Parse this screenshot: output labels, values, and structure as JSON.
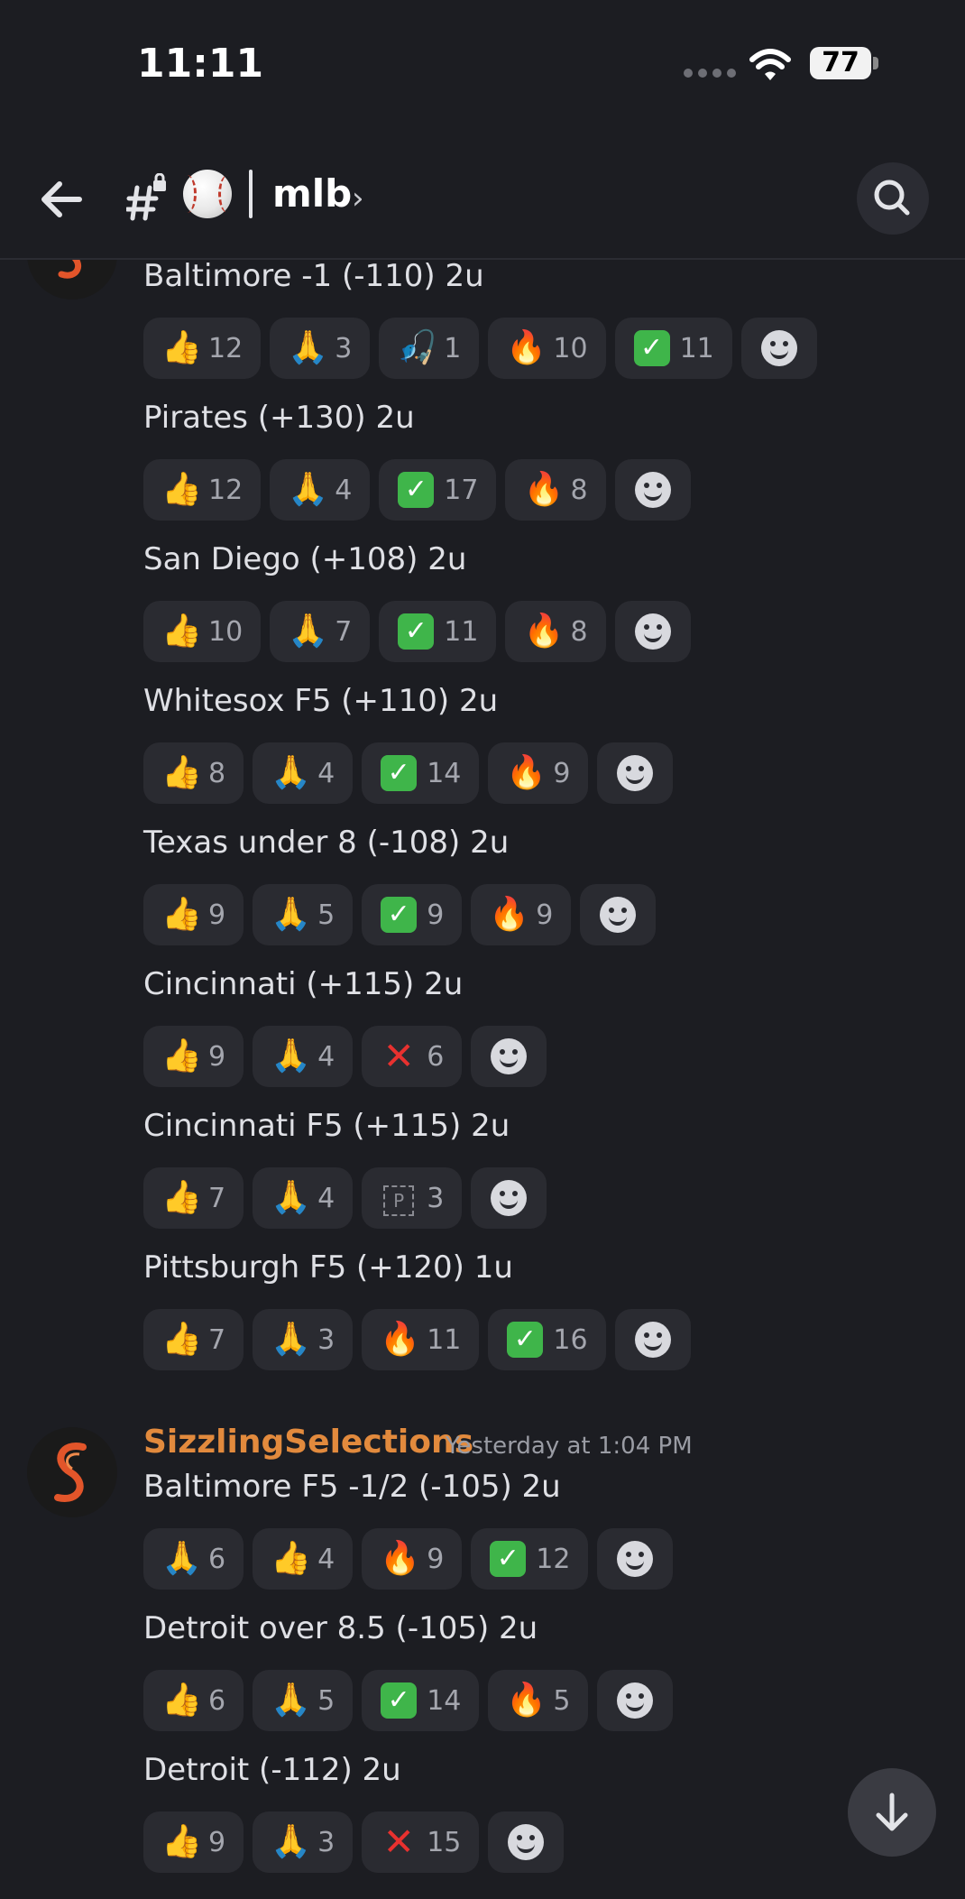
{
  "status_bar": {
    "time": "11:11",
    "battery": "77"
  },
  "header": {
    "channel_name": "mlb"
  },
  "messages": [
    {
      "lines": [
        {
          "text": "Baltimore -1 (-110) 2u",
          "reactions": [
            {
              "emoji": "👍",
              "count": "12"
            },
            {
              "emoji": "🙏",
              "count": "3"
            },
            {
              "emoji": "🎣",
              "count": "1"
            },
            {
              "emoji": "🔥",
              "count": "10"
            },
            {
              "emoji": "✅",
              "count": "11"
            }
          ]
        },
        {
          "text": "Pirates (+130) 2u",
          "reactions": [
            {
              "emoji": "👍",
              "count": "12"
            },
            {
              "emoji": "🙏",
              "count": "4"
            },
            {
              "emoji": "✅",
              "count": "17"
            },
            {
              "emoji": "🔥",
              "count": "8"
            }
          ]
        },
        {
          "text": "San Diego (+108) 2u",
          "reactions": [
            {
              "emoji": "👍",
              "count": "10"
            },
            {
              "emoji": "🙏",
              "count": "7"
            },
            {
              "emoji": "✅",
              "count": "11"
            },
            {
              "emoji": "🔥",
              "count": "8"
            }
          ]
        },
        {
          "text": "Whitesox F5 (+110) 2u",
          "reactions": [
            {
              "emoji": "👍",
              "count": "8"
            },
            {
              "emoji": "🙏",
              "count": "4"
            },
            {
              "emoji": "✅",
              "count": "14"
            },
            {
              "emoji": "🔥",
              "count": "9"
            }
          ]
        },
        {
          "text": "Texas under 8 (-108) 2u",
          "reactions": [
            {
              "emoji": "👍",
              "count": "9"
            },
            {
              "emoji": "🙏",
              "count": "5"
            },
            {
              "emoji": "✅",
              "count": "9"
            },
            {
              "emoji": "🔥",
              "count": "9"
            }
          ]
        },
        {
          "text": "Cincinnati (+115) 2u",
          "reactions": [
            {
              "emoji": "👍",
              "count": "9"
            },
            {
              "emoji": "🙏",
              "count": "4"
            },
            {
              "emoji": "❌",
              "count": "6"
            }
          ]
        },
        {
          "text": "Cincinnati F5 (+115) 2u",
          "reactions": [
            {
              "emoji": "👍",
              "count": "7"
            },
            {
              "emoji": "🙏",
              "count": "4"
            },
            {
              "emoji": "🅿",
              "count": "3"
            }
          ]
        },
        {
          "text": "Pittsburgh F5 (+120) 1u",
          "reactions": [
            {
              "emoji": "👍",
              "count": "7"
            },
            {
              "emoji": "🙏",
              "count": "3"
            },
            {
              "emoji": "🔥",
              "count": "11"
            },
            {
              "emoji": "✅",
              "count": "16"
            }
          ]
        }
      ]
    },
    {
      "author": "SizzlingSelections",
      "timestamp": "Yesterday at 1:04 PM",
      "lines": [
        {
          "text": "Baltimore F5 -1/2 (-105) 2u",
          "reactions": [
            {
              "emoji": "🙏",
              "count": "6"
            },
            {
              "emoji": "👍",
              "count": "4"
            },
            {
              "emoji": "🔥",
              "count": "9"
            },
            {
              "emoji": "✅",
              "count": "12"
            }
          ]
        },
        {
          "text": "Detroit over 8.5 (-105) 2u",
          "reactions": [
            {
              "emoji": "👍",
              "count": "6"
            },
            {
              "emoji": "🙏",
              "count": "5"
            },
            {
              "emoji": "✅",
              "count": "14"
            },
            {
              "emoji": "🔥",
              "count": "5"
            }
          ]
        },
        {
          "text": "Detroit (-112) 2u",
          "reactions": [
            {
              "emoji": "👍",
              "count": "9"
            },
            {
              "emoji": "🙏",
              "count": "3"
            },
            {
              "emoji": "❌",
              "count": "15"
            }
          ]
        }
      ]
    }
  ]
}
